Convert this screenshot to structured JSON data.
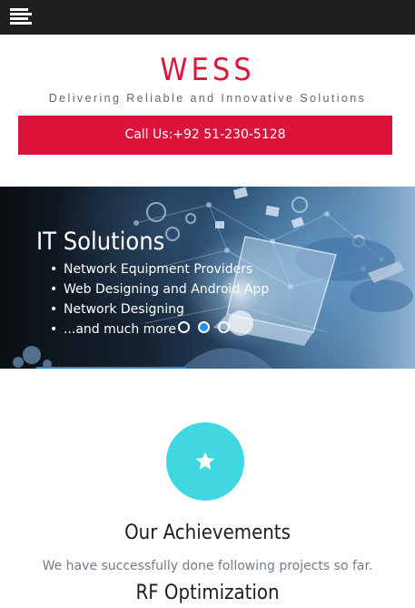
{
  "header": {
    "menu_icon": "hamburger-menu-icon"
  },
  "brand": {
    "name": "WESS",
    "tagline": "Delivering Reliable and Innovative Solutions",
    "call_button": "Call Us:+92 51-230-5128",
    "accent_color": "#dc143c"
  },
  "slider": {
    "title": "IT Solutions",
    "items": [
      "Network Equipment Providers",
      "Web Designing and Android App",
      "Network Designing",
      "...and much more"
    ],
    "slide_count": 3,
    "active_slide": 2
  },
  "achievements": {
    "icon": "star-icon",
    "icon_bg": "#40d7e1",
    "title": "Our Achievements",
    "subtitle": "We have successfully done following projects so far.",
    "first_project": "RF Optimization"
  }
}
